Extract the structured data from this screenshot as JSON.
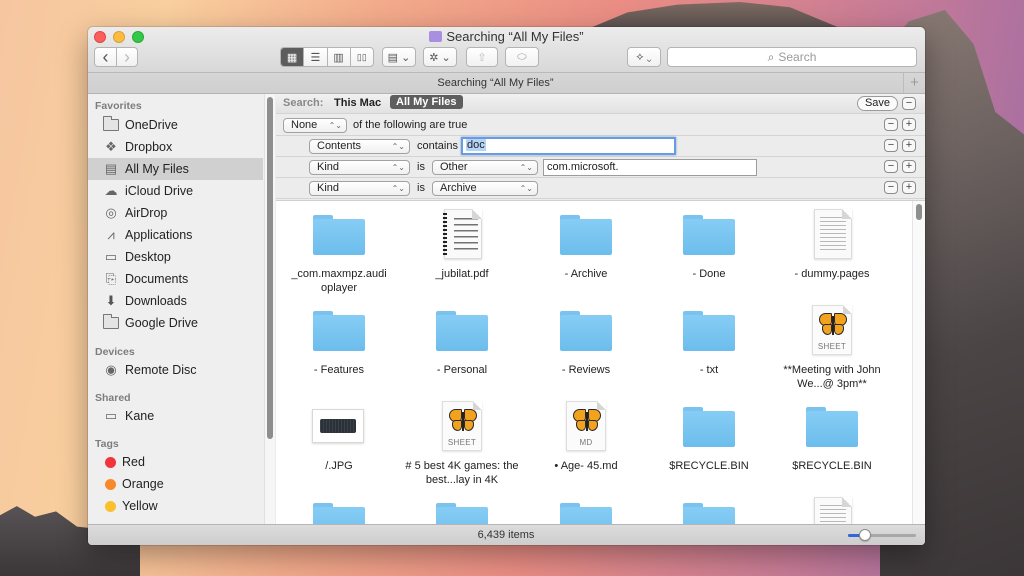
{
  "window": {
    "title": "Searching “All My Files”",
    "tab_label": "Searching “All My Files”",
    "tab_add_label": "+"
  },
  "toolbar": {
    "back_icon": "‹",
    "forward_icon": "›",
    "view_modes": [
      {
        "name": "icon-view",
        "glyph": "▦",
        "active": true
      },
      {
        "name": "list-view",
        "glyph": "☰",
        "active": false
      },
      {
        "name": "column-view",
        "glyph": "▥",
        "active": false
      },
      {
        "name": "cover-flow-view",
        "glyph": "▯▯",
        "active": false
      }
    ],
    "arrange_glyph": "▤ ⌄",
    "action_glyph": "✲ ⌄",
    "share_glyph": "⇧",
    "tag_glyph": "⬭",
    "dropbox_glyph": "⟡ ⌄",
    "search_placeholder": "Search",
    "search_icon": "⌕"
  },
  "sidebar": {
    "sections": [
      {
        "heading": "Favorites"
      },
      {
        "heading": "Devices"
      },
      {
        "heading": "Shared"
      },
      {
        "heading": "Tags"
      }
    ],
    "favorites": [
      {
        "label": "OneDrive",
        "icon": "folder-icon"
      },
      {
        "label": "Dropbox",
        "icon": "dropbox-icon"
      },
      {
        "label": "All My Files",
        "icon": "all-my-files-icon",
        "selected": true
      },
      {
        "label": "iCloud Drive",
        "icon": "cloud-icon"
      },
      {
        "label": "AirDrop",
        "icon": "airdrop-icon"
      },
      {
        "label": "Applications",
        "icon": "applications-icon"
      },
      {
        "label": "Desktop",
        "icon": "desktop-icon"
      },
      {
        "label": "Documents",
        "icon": "documents-icon"
      },
      {
        "label": "Downloads",
        "icon": "downloads-icon"
      },
      {
        "label": "Google Drive",
        "icon": "folder-icon"
      }
    ],
    "devices": [
      {
        "label": "Remote Disc",
        "icon": "disc-icon"
      }
    ],
    "shared": [
      {
        "label": "Kane",
        "icon": "computer-icon"
      }
    ],
    "tags": [
      {
        "label": "Red",
        "color": "#f0353c"
      },
      {
        "label": "Orange",
        "color": "#f8892a"
      },
      {
        "label": "Yellow",
        "color": "#fbc02e"
      }
    ]
  },
  "search": {
    "scope_label": "Search:",
    "scope_options": [
      "This Mac",
      "All My Files"
    ],
    "scope_selected": "All My Files",
    "save_label": "Save",
    "minus": "−",
    "plus": "+",
    "match_popup": "None",
    "match_text": "of the following are true",
    "rules": [
      {
        "attribute": "Contents",
        "operator": "contains",
        "value": "doc"
      },
      {
        "attribute": "Kind",
        "operator": "is",
        "kind": "Other",
        "value": "com.microsoft."
      },
      {
        "attribute": "Kind",
        "operator": "is",
        "kind": "Archive"
      }
    ]
  },
  "files": [
    {
      "name": "_com.maxmpz.audi oplayer",
      "type": "folder"
    },
    {
      "name": "_jubilat.pdf",
      "type": "pdf"
    },
    {
      "name": "- Archive",
      "type": "folder"
    },
    {
      "name": "- Done",
      "type": "folder"
    },
    {
      "name": "- dummy.pages",
      "type": "doc"
    },
    {
      "name": "- Features",
      "type": "folder"
    },
    {
      "name": "- Personal",
      "type": "folder"
    },
    {
      "name": "- Reviews",
      "type": "folder"
    },
    {
      "name": "- txt",
      "type": "folder"
    },
    {
      "name": "**Meeting with John We...@ 3pm**",
      "type": "ulysses",
      "badge": "SHEET"
    },
    {
      "name": "/.JPG",
      "type": "image"
    },
    {
      "name": "# 5 best 4K games: the best...lay in 4K",
      "type": "ulysses",
      "badge": "SHEET"
    },
    {
      "name": "• Age- 45.md",
      "type": "ulysses",
      "badge": "MD"
    },
    {
      "name": "$RECYCLE.BIN",
      "type": "folder"
    },
    {
      "name": "$RECYCLE.BIN",
      "type": "folder"
    }
  ],
  "status": {
    "item_count": "6,439 items",
    "icon_size_fraction": 0.25
  }
}
